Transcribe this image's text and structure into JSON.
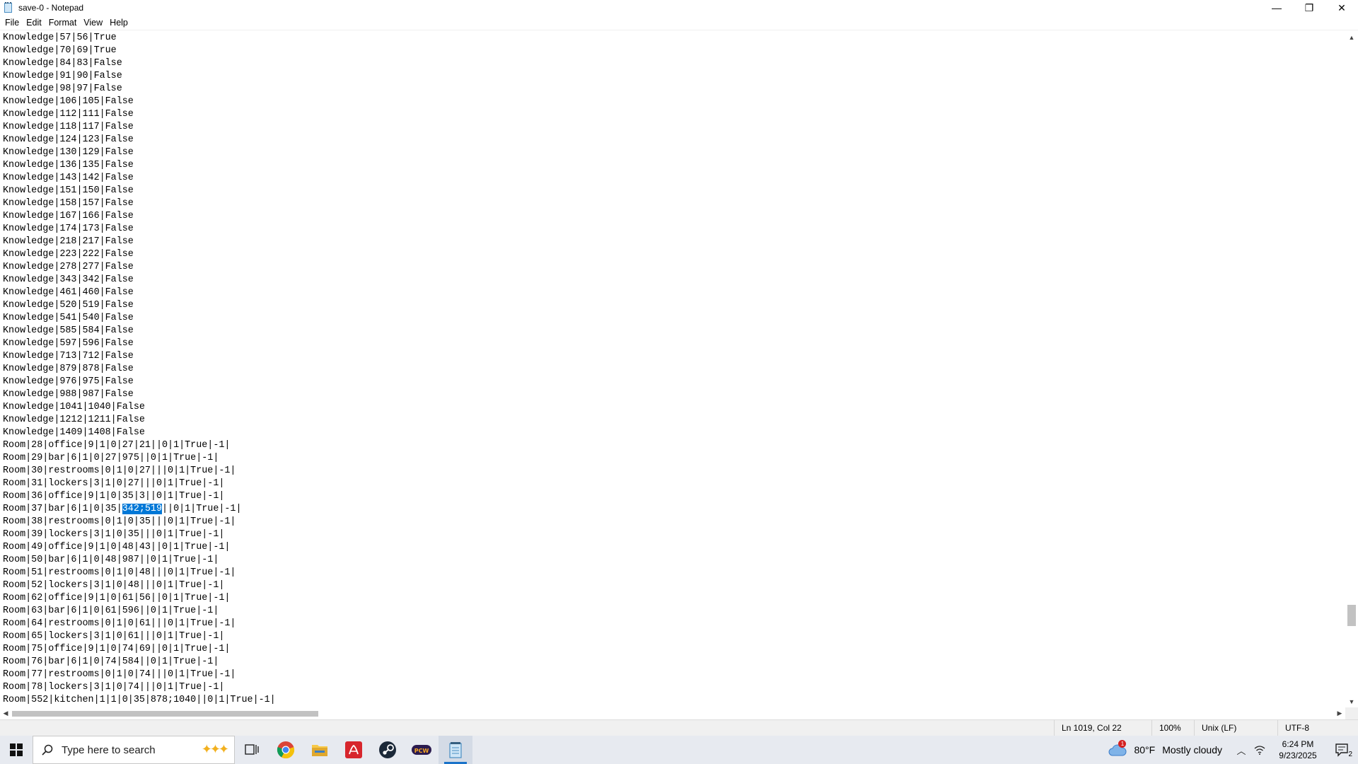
{
  "window": {
    "title": "save-0 - Notepad",
    "minimize_glyph": "—",
    "restore_glyph": "❐",
    "close_glyph": "✕"
  },
  "menu": [
    "File",
    "Edit",
    "Format",
    "View",
    "Help"
  ],
  "editor": {
    "lines": [
      "Knowledge|57|56|True",
      "Knowledge|70|69|True",
      "Knowledge|84|83|False",
      "Knowledge|91|90|False",
      "Knowledge|98|97|False",
      "Knowledge|106|105|False",
      "Knowledge|112|111|False",
      "Knowledge|118|117|False",
      "Knowledge|124|123|False",
      "Knowledge|130|129|False",
      "Knowledge|136|135|False",
      "Knowledge|143|142|False",
      "Knowledge|151|150|False",
      "Knowledge|158|157|False",
      "Knowledge|167|166|False",
      "Knowledge|174|173|False",
      "Knowledge|218|217|False",
      "Knowledge|223|222|False",
      "Knowledge|278|277|False",
      "Knowledge|343|342|False",
      "Knowledge|461|460|False",
      "Knowledge|520|519|False",
      "Knowledge|541|540|False",
      "Knowledge|585|584|False",
      "Knowledge|597|596|False",
      "Knowledge|713|712|False",
      "Knowledge|879|878|False",
      "Knowledge|976|975|False",
      "Knowledge|988|987|False",
      "Knowledge|1041|1040|False",
      "Knowledge|1212|1211|False",
      "Knowledge|1409|1408|False",
      "Room|28|office|9|1|0|27|21||0|1|True|-1|",
      "Room|29|bar|6|1|0|27|975||0|1|True|-1|",
      "Room|30|restrooms|0|1|0|27|||0|1|True|-1|",
      "Room|31|lockers|3|1|0|27|||0|1|True|-1|",
      "Room|36|office|9|1|0|35|3||0|1|True|-1|",
      {
        "before": "Room|37|bar|6|1|0|35|",
        "selected": "342;519",
        "after": "||0|1|True|-1|"
      },
      "Room|38|restrooms|0|1|0|35|||0|1|True|-1|",
      "Room|39|lockers|3|1|0|35|||0|1|True|-1|",
      "Room|49|office|9|1|0|48|43||0|1|True|-1|",
      "Room|50|bar|6|1|0|48|987||0|1|True|-1|",
      "Room|51|restrooms|0|1|0|48|||0|1|True|-1|",
      "Room|52|lockers|3|1|0|48|||0|1|True|-1|",
      "Room|62|office|9|1|0|61|56||0|1|True|-1|",
      "Room|63|bar|6|1|0|61|596||0|1|True|-1|",
      "Room|64|restrooms|0|1|0|61|||0|1|True|-1|",
      "Room|65|lockers|3|1|0|61|||0|1|True|-1|",
      "Room|75|office|9|1|0|74|69||0|1|True|-1|",
      "Room|76|bar|6|1|0|74|584||0|1|True|-1|",
      "Room|77|restrooms|0|1|0|74|||0|1|True|-1|",
      "Room|78|lockers|3|1|0|74|||0|1|True|-1|",
      "Room|552|kitchen|1|1|0|35|878;1040||0|1|True|-1|"
    ]
  },
  "status": {
    "position": "Ln 1019, Col 22",
    "zoom": "100%",
    "line_ending": "Unix (LF)",
    "encoding": "UTF-8"
  },
  "taskbar": {
    "search_placeholder": "Type here to search",
    "apps": [
      "chrome-icon",
      "file-explorer-icon",
      "adobe-icon",
      "steam-icon",
      "game-launcher-icon",
      "notepad-icon"
    ],
    "weather": {
      "temp": "80°F",
      "condition": "Mostly cloudy",
      "alert_count": "1"
    },
    "clock": {
      "time": "6:24 PM",
      "date": "9/23/2025"
    },
    "notification_count": "2"
  },
  "colors": {
    "selection": "#0078d7",
    "taskbar": "#e7eaf0",
    "statusbar": "#f0f0f0"
  }
}
